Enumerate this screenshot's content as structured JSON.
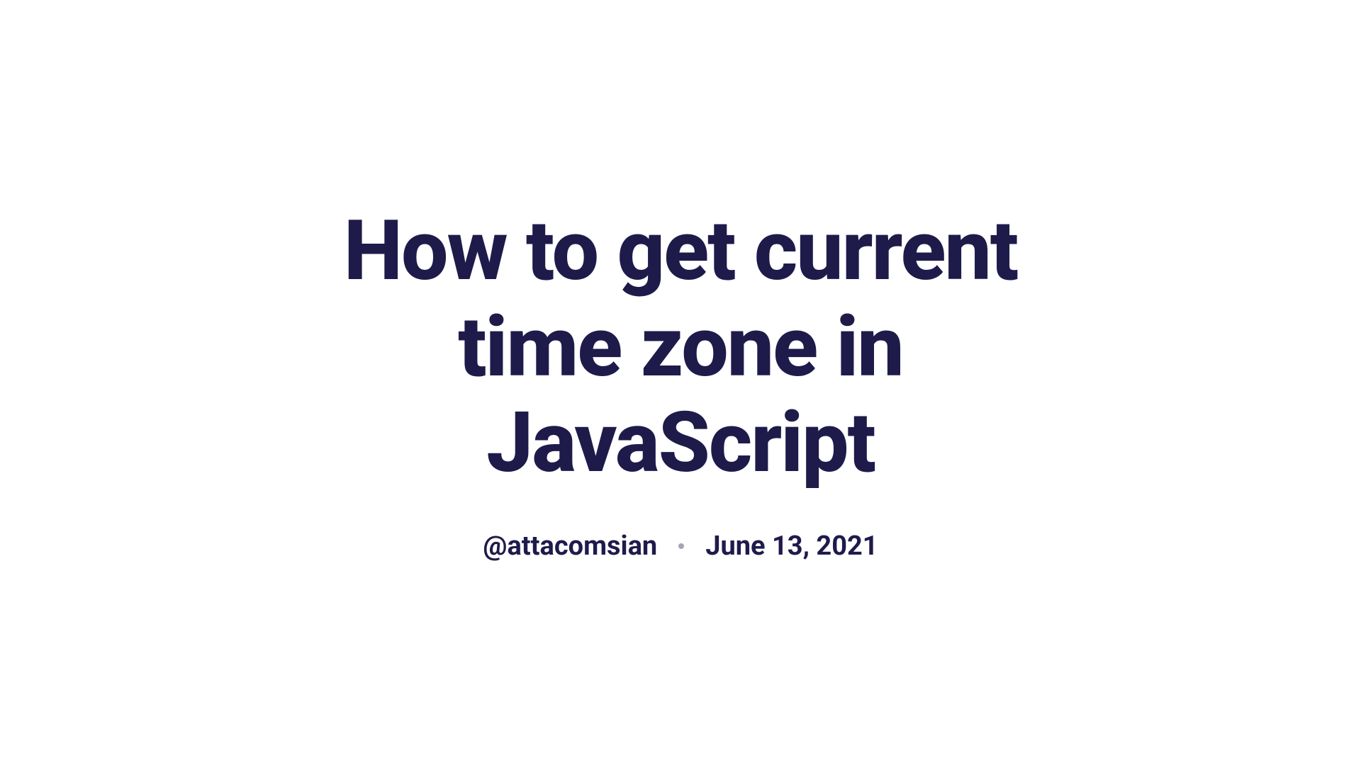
{
  "article": {
    "title": "How to get current time zone in JavaScript",
    "author": "@attacomsian",
    "date": "June 13, 2021"
  }
}
